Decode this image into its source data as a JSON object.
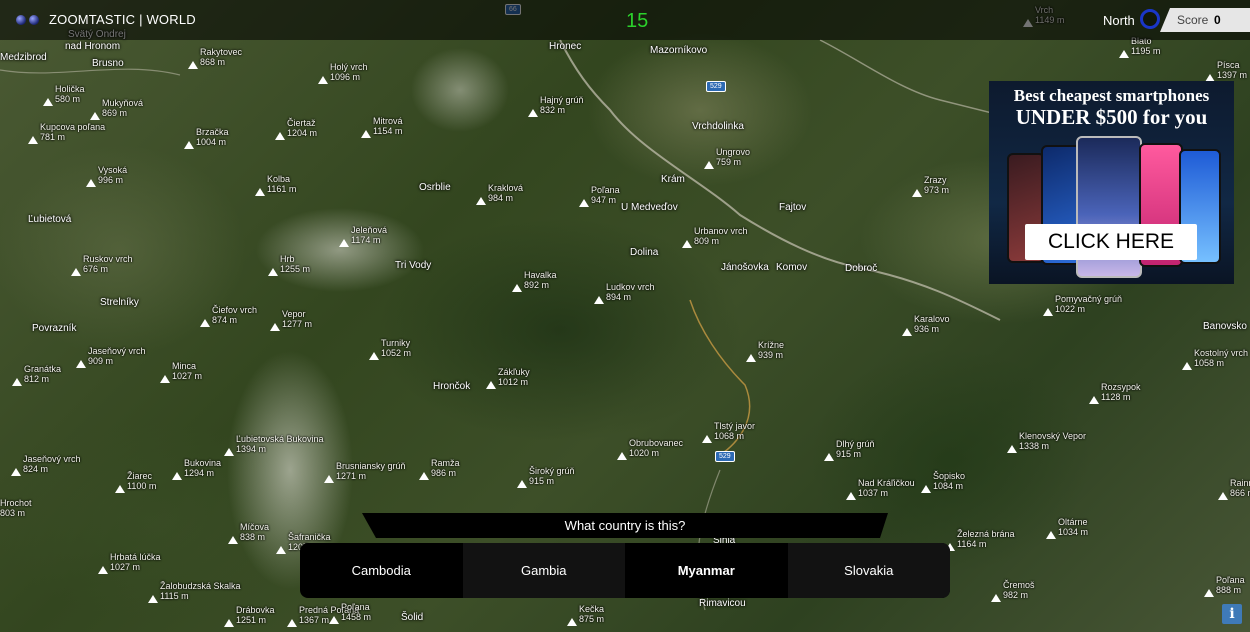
{
  "header": {
    "brand": "ZOOMTASTIC | WORLD",
    "timer": "15",
    "orientation_label": "North",
    "score_label": "Score",
    "score_value": "0"
  },
  "ad": {
    "line1": "Best cheapest smartphones",
    "line2": "UNDER $500 for you",
    "cta": "CLICK HERE"
  },
  "quiz": {
    "question": "What country is this?",
    "options": [
      "Cambodia",
      "Gambia",
      "Myanmar",
      "Slovakia"
    ]
  },
  "info_icon": "i",
  "map": {
    "peaks": [
      {
        "name": "Rakytovec",
        "elev": "868 m"
      },
      {
        "name": "Holý vrch",
        "elev": "1096 m"
      },
      {
        "name": "Hajný grúň",
        "elev": "832 m"
      },
      {
        "name": "Holička",
        "elev": "580 m"
      },
      {
        "name": "Mukyňová",
        "elev": "869 m"
      },
      {
        "name": "Kupcova poľana",
        "elev": "781 m"
      },
      {
        "name": "Brzačka",
        "elev": "1004 m"
      },
      {
        "name": "Čiertaž",
        "elev": "1204 m"
      },
      {
        "name": "Mitrová",
        "elev": "1154 m"
      },
      {
        "name": "Vysoká",
        "elev": "996 m"
      },
      {
        "name": "Kolba",
        "elev": "1161 m"
      },
      {
        "name": "Kraklová",
        "elev": "984 m"
      },
      {
        "name": "Poľana",
        "elev": "947 m"
      },
      {
        "name": "Ungrovo",
        "elev": "759 m"
      },
      {
        "name": "Zrazy",
        "elev": "973 m"
      },
      {
        "name": "Jeleňová",
        "elev": "1174 m"
      },
      {
        "name": "Urbanov vrch",
        "elev": "809 m"
      },
      {
        "name": "Ruskov vrch",
        "elev": "676 m"
      },
      {
        "name": "Hrb",
        "elev": "1255 m"
      },
      {
        "name": "Havalka",
        "elev": "892 m"
      },
      {
        "name": "Ludkov vrch",
        "elev": "894 m"
      },
      {
        "name": "Pomyvačný grúň",
        "elev": "1022 m"
      },
      {
        "name": "Čiefov vrch",
        "elev": "874 m"
      },
      {
        "name": "Vepor",
        "elev": "1277 m"
      },
      {
        "name": "Karalovo",
        "elev": "936 m"
      },
      {
        "name": "Turniky",
        "elev": "1052 m"
      },
      {
        "name": "Krížne",
        "elev": "939 m"
      },
      {
        "name": "Jaseňový vrch",
        "elev": "909 m"
      },
      {
        "name": "Granátka",
        "elev": "812 m"
      },
      {
        "name": "Minca",
        "elev": "1027 m"
      },
      {
        "name": "Zákľuky",
        "elev": "1012 m"
      },
      {
        "name": "Kostolný vrch",
        "elev": "1058 m"
      },
      {
        "name": "Rozsypok",
        "elev": "1128 m"
      },
      {
        "name": "Tlstý javor",
        "elev": "1068 m"
      },
      {
        "name": "Obrubovanec",
        "elev": "1020 m"
      },
      {
        "name": "Ľubietovská Bukovina",
        "elev": "1394 m"
      },
      {
        "name": "Dlhý grúň",
        "elev": "915 m"
      },
      {
        "name": "Klenovský Vepor",
        "elev": "1338 m"
      },
      {
        "name": "Jaseňový vrch",
        "elev": "824 m"
      },
      {
        "name": "Bukovina",
        "elev": "1294 m"
      },
      {
        "name": "Brusniansky grúň",
        "elev": "1271 m"
      },
      {
        "name": "Ramža",
        "elev": "986 m"
      },
      {
        "name": "Široký grúň",
        "elev": "915 m"
      },
      {
        "name": "Žiarec",
        "elev": "1100 m"
      },
      {
        "name": "Nad Kráľičkou",
        "elev": "1037 m"
      },
      {
        "name": "Šopisko",
        "elev": "1084 m"
      },
      {
        "name": "Hrochot",
        "elev": "803 m"
      },
      {
        "name": "Míčova",
        "elev": "838 m"
      },
      {
        "name": "Šafranička",
        "elev": "1207 m"
      },
      {
        "name": "Oltárne",
        "elev": "1034 m"
      },
      {
        "name": "Železná brána",
        "elev": "1164 m"
      },
      {
        "name": "Hrbatá lúčka",
        "elev": "1027 m"
      },
      {
        "name": "Žalobudzská Skalka",
        "elev": "1115 m"
      },
      {
        "name": "Čremoš",
        "elev": "982 m"
      },
      {
        "name": "Drábovka",
        "elev": "1251 m"
      },
      {
        "name": "Predná Poľana",
        "elev": "1367 m"
      },
      {
        "name": "Kečka",
        "elev": "875 m"
      },
      {
        "name": "Poľana",
        "elev": "1458 m"
      },
      {
        "name": "Poľana",
        "elev": "888 m"
      },
      {
        "name": "Rainn",
        "elev": "866 m"
      },
      {
        "name": "Blato",
        "elev": "1195 m"
      },
      {
        "name": "Písca",
        "elev": "1397 m"
      },
      {
        "name": "Vrch",
        "elev": "1149 m"
      }
    ],
    "towns": [
      "Medzibrod",
      "Brusno",
      "nad Hronom",
      "Svätý Ondrej",
      "Hronec",
      "Mazorníkovo",
      "Vrchdolinka",
      "Osrblie",
      "Krám",
      "U Medveďov",
      "Fajtov",
      "Ľubietová",
      "Dolina",
      "Tri Vody",
      "Jánošovka",
      "Komov",
      "Dobroč",
      "Strelníky",
      "Povrazník",
      "Banovsko",
      "Hrončok",
      "Šihla",
      "Rimavicou",
      "Šolid"
    ],
    "road_shields": [
      "529",
      "529",
      "66"
    ]
  }
}
